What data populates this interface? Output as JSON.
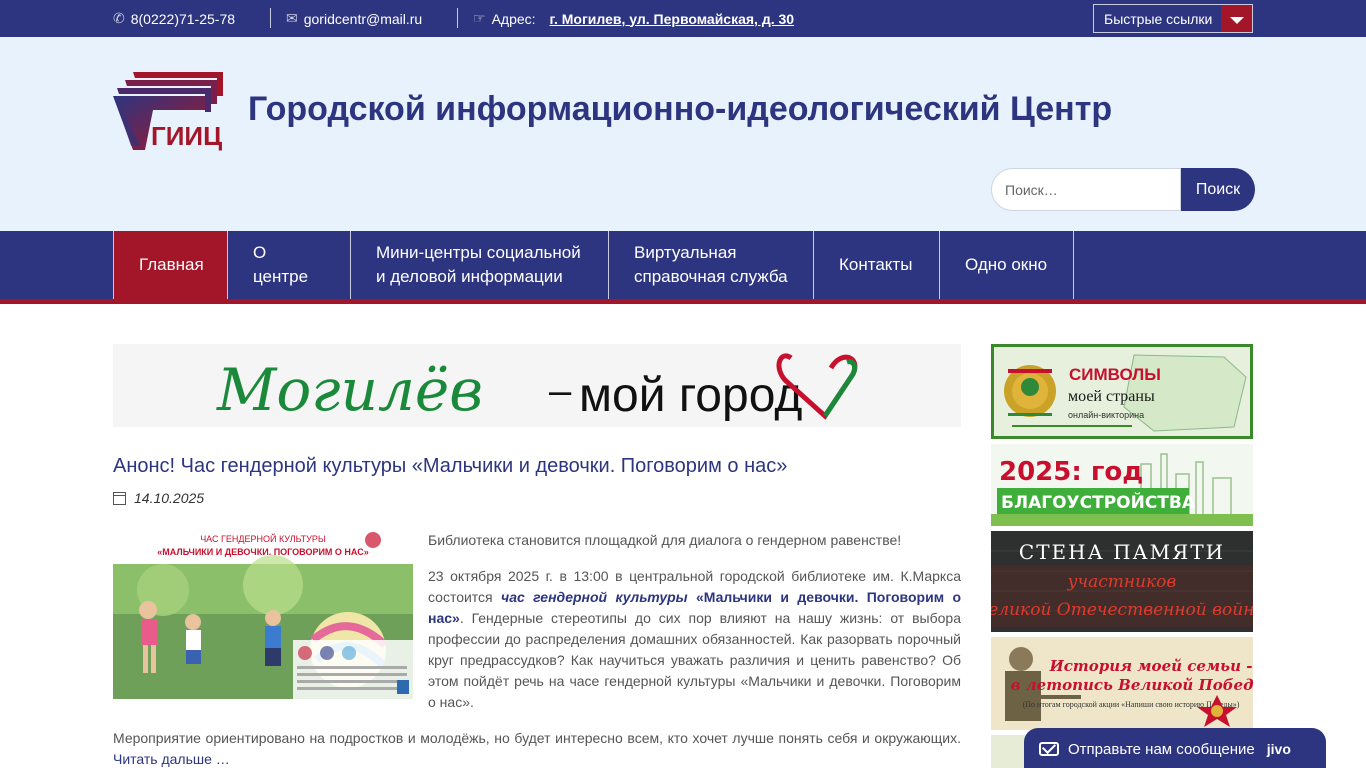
{
  "topbar": {
    "phone": "8(0222)71-25-78",
    "email": "goridcentr@mail.ru",
    "address_label": "Адрес:",
    "address": "г. Могилев, ул. Первомайская, д. 30",
    "quick_links": "Быстрые ссылки"
  },
  "header": {
    "logo_text": "ГИИЦ",
    "title": "Городской информационно-идеологический Центр",
    "search_placeholder": "Поиск…",
    "search_button": "Поиск"
  },
  "nav": {
    "items": [
      {
        "label": "Главная"
      },
      {
        "label": "О центре"
      },
      {
        "label": "Мини-центры социальной и деловой информации"
      },
      {
        "label": "Виртуальная справочная служба"
      },
      {
        "label": "Контакты"
      },
      {
        "label": "Одно окно"
      }
    ]
  },
  "banner": {
    "script": "Могилёв",
    "dash": "–",
    "slogan": "мой город"
  },
  "post": {
    "title": "Анонс! Час гендерной культуры «Мальчики и девочки. Поговорим о нас»",
    "date": "14.10.2025",
    "image": {
      "line1": "ЧАС ГЕНДЕРНОЙ КУЛЬТУРЫ",
      "line2": "«МАЛЬЧИКИ И ДЕВОЧКИ. ПОГОВОРИМ О НАС»"
    },
    "p1": "Библиотека становится площадкой для диалога о гендерном равенстве!",
    "p2_start": "23 октября 2025 г. в 13:00 в центральной городской библиотеке им. К.Маркса состоится ",
    "p2_italic": "час гендерной культуры",
    "p2_bold": " «Мальчики и девочки. Поговорим о нас»",
    "p2_end": ". Гендерные стереотипы до сих пор влияют на нашу жизнь: от выбора профессии до распределения домашних обязанностей. Как разорвать порочный круг предрассудков? Как научиться уважать различия и ценить равенство? Об этом пойдёт речь на часе гендерной культуры «Мальчики и девочки. Поговорим о нас».",
    "more": "Мероприятие ориентировано на подростков и молодёжь, но будет интересно всем, кто хочет лучше понять себя и окружающих. ",
    "read_more": "Читать дальше …"
  },
  "sidebar": {
    "b1": {
      "title": "СИМВОЛЫ",
      "sub": "моей страны",
      "small": "онлайн-викторина"
    },
    "b2": {
      "line1": "2025: год",
      "line2": "БЛАГОУСТРОЙСТВА"
    },
    "b3": {
      "line1": "СТЕНА ПАМЯТИ",
      "line2": "участников",
      "line3": "Великой Отечественной войны"
    },
    "b4": {
      "line1": "История моей семьи -",
      "line2": "в летопись Великой Победы!",
      "small": "(По итогам городской акции «Напиши свою историю Победы»)"
    }
  },
  "chat": {
    "label": "Отправьте нам сообщение",
    "brand": "jivo"
  }
}
